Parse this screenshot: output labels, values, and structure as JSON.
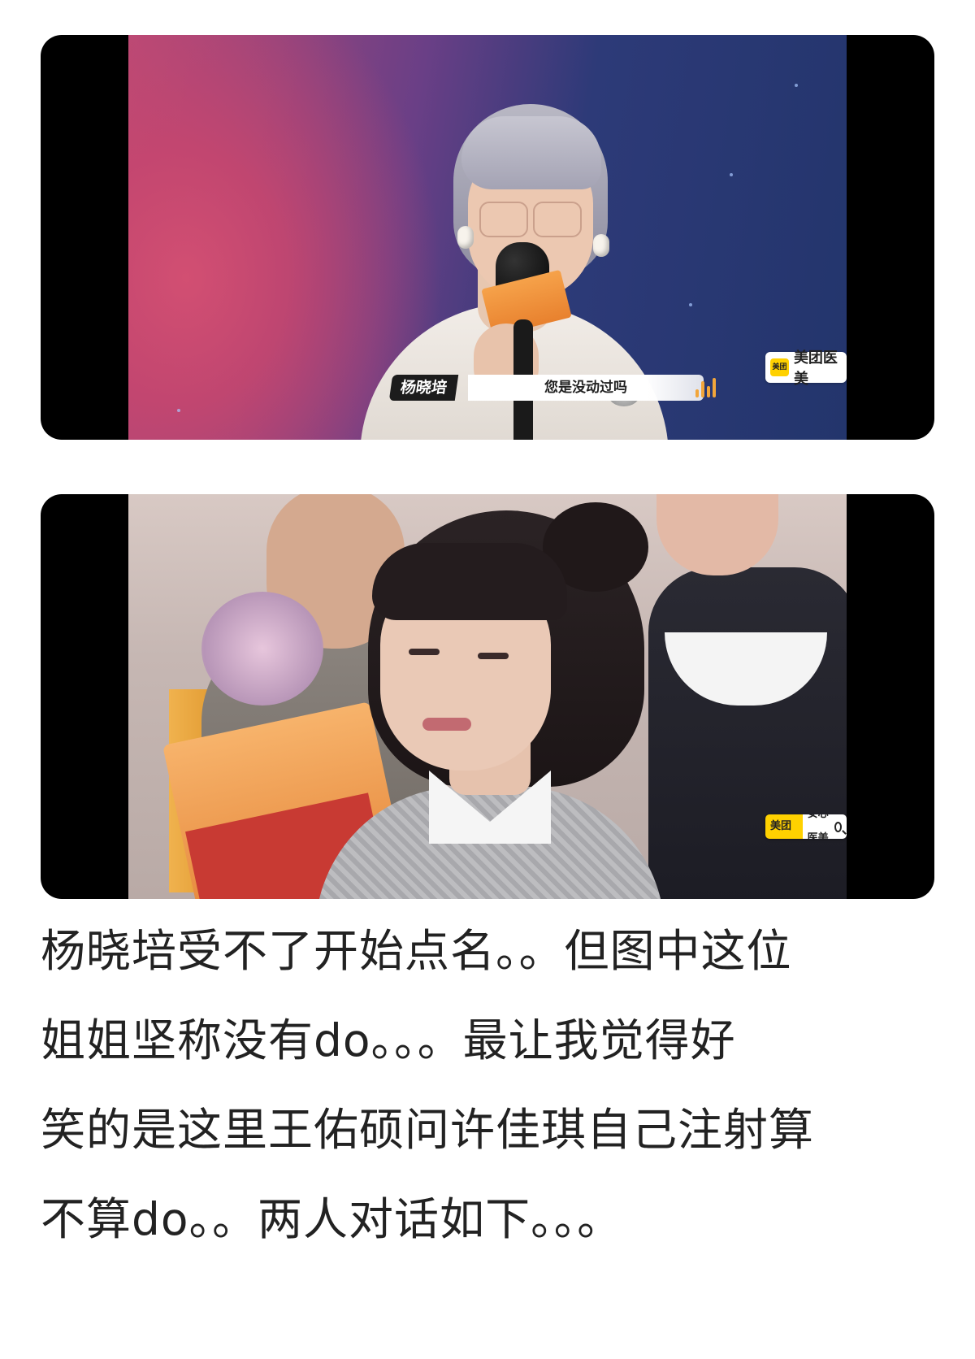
{
  "video_frames": [
    {
      "name_tag": "杨晓培",
      "subtitle": "您是没动过吗",
      "brand_logo_text": "美团",
      "brand_text": "美团医美"
    },
    {
      "app_badge_left": "美团App",
      "app_badge_right": "安心医美",
      "badge_icon": "search-icon"
    }
  ],
  "post": {
    "lines": [
      "杨晓培受不了开始点名。。但图中这位",
      "姐姐坚称没有do。。。最让我觉得好",
      "笑的是这里王佑硕问许佳琪自己注射算",
      "不算do。。两人对话如下。。。"
    ]
  },
  "colors": {
    "text": "#222222",
    "brand_yellow": "#ffd100",
    "caption_accent": "#f2a63b"
  }
}
